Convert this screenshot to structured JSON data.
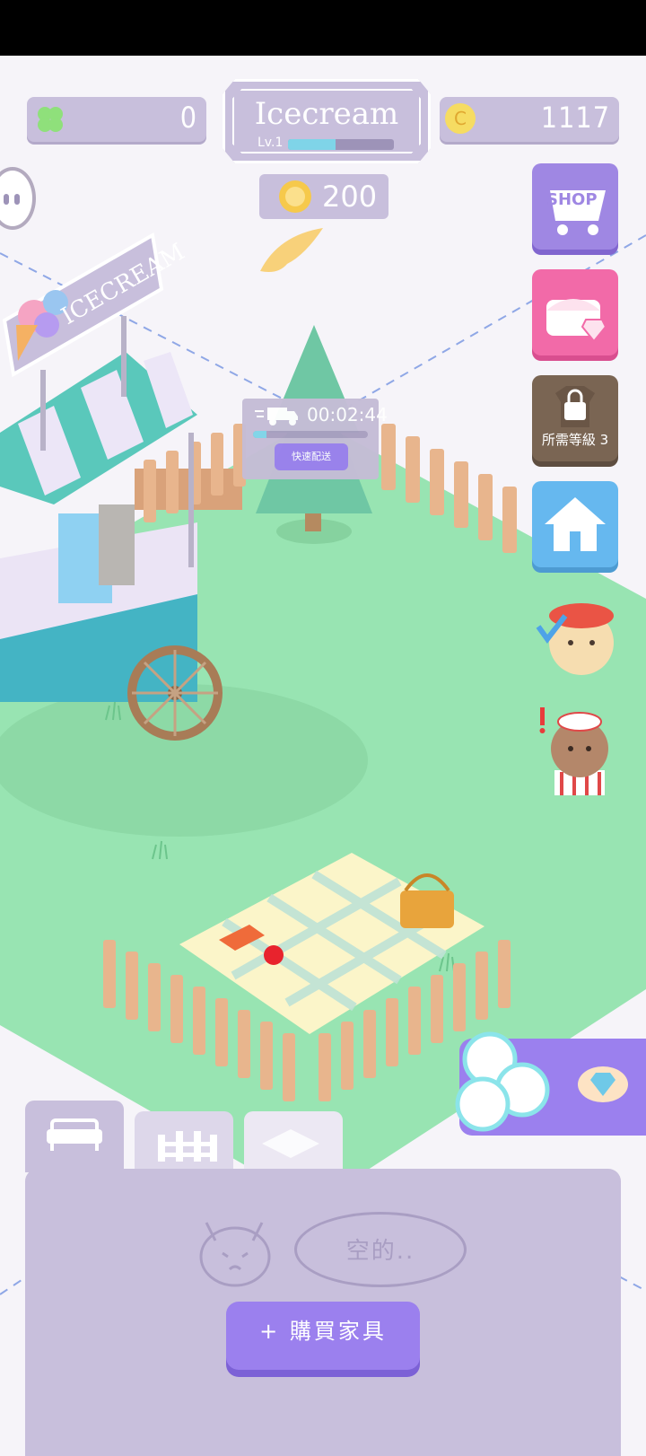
{
  "hud": {
    "clover_count": "0",
    "coin_count": "1117",
    "coin_symbol": "C",
    "shop_title": "Icecream",
    "level_label": "Lv.1",
    "level_progress": 0.45,
    "medal_count": "200"
  },
  "side_buttons": {
    "shop_label": "SHOP",
    "locked_label": "所需等級 3"
  },
  "scene": {
    "cart_sign": "ICECREAM",
    "delivery_timer": "00:02:44",
    "delivery_button": "快速配送",
    "delivery_progress": 0.12
  },
  "inventory": {
    "empty_text": "空的..",
    "buy_button": "+ 購買家具"
  },
  "colors": {
    "panel": "#c8bfdc",
    "accent_purple": "#9b80ee",
    "grass": "#98e4b2",
    "shop_button": "#9f87e3",
    "chest_button": "#f26aa8",
    "home_button": "#66b8ef"
  }
}
